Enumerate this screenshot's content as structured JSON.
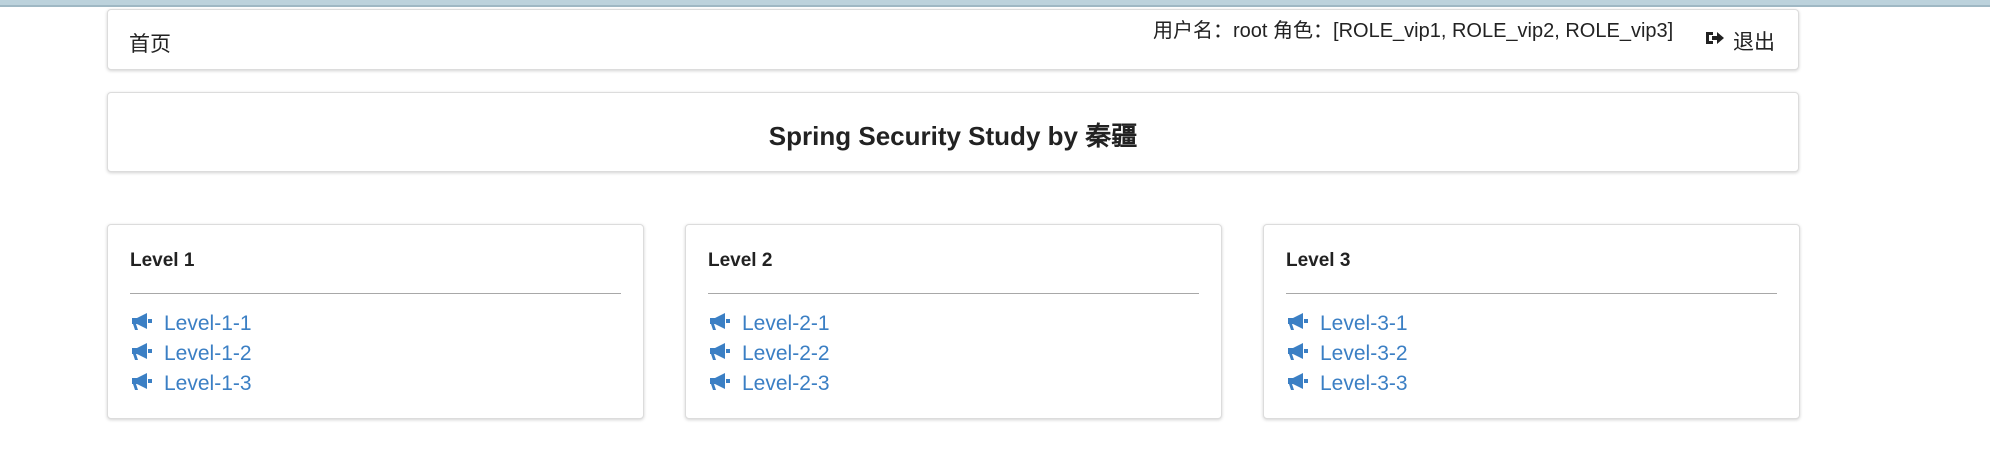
{
  "header": {
    "home_label": "首页",
    "user_info": "用户名：root 角色：[ROLE_vip1, ROLE_vip2, ROLE_vip3]",
    "logout_label": "退出",
    "logout_icon": "sign-out-icon"
  },
  "title": "Spring Security Study by 秦疆",
  "levels": [
    {
      "title": "Level 1",
      "links": [
        "Level-1-1",
        "Level-1-2",
        "Level-1-3"
      ]
    },
    {
      "title": "Level 2",
      "links": [
        "Level-2-1",
        "Level-2-2",
        "Level-2-3"
      ]
    },
    {
      "title": "Level 3",
      "links": [
        "Level-3-1",
        "Level-3-2",
        "Level-3-3"
      ]
    }
  ],
  "colors": {
    "link": "#3b7fc4",
    "text": "#222222",
    "top_strip": "#bcd2dc"
  }
}
